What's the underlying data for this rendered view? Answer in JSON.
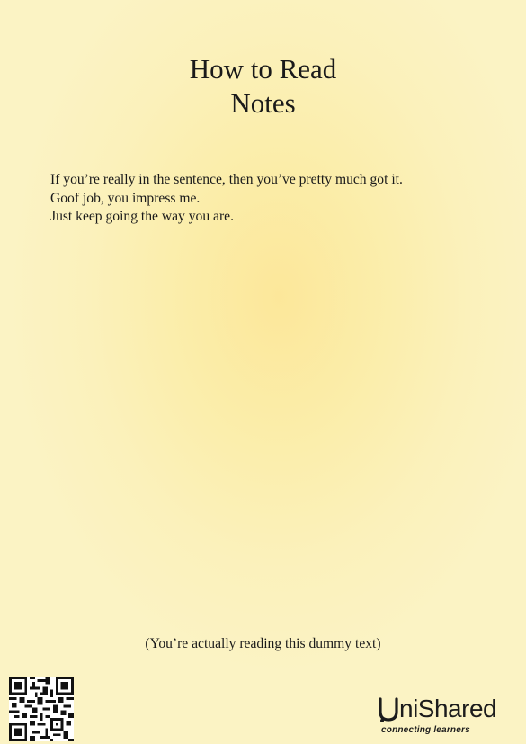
{
  "document": {
    "title_lines": [
      "How to Read",
      "Notes"
    ],
    "body_lines": [
      "If you’re really in the sentence, then you’ve pretty much got it.",
      "Goof job, you impress me.",
      "Just keep going the way you are."
    ],
    "footer_note": "(You’re actually reading this dummy text)"
  },
  "branding": {
    "logo_text": "niShared",
    "logo_tagline": "connecting learners",
    "qr_code": "qr-code-icon"
  },
  "colors": {
    "background_center": "#fce79a",
    "background_edge": "#fbf3c4",
    "text": "#1a1a1a"
  }
}
